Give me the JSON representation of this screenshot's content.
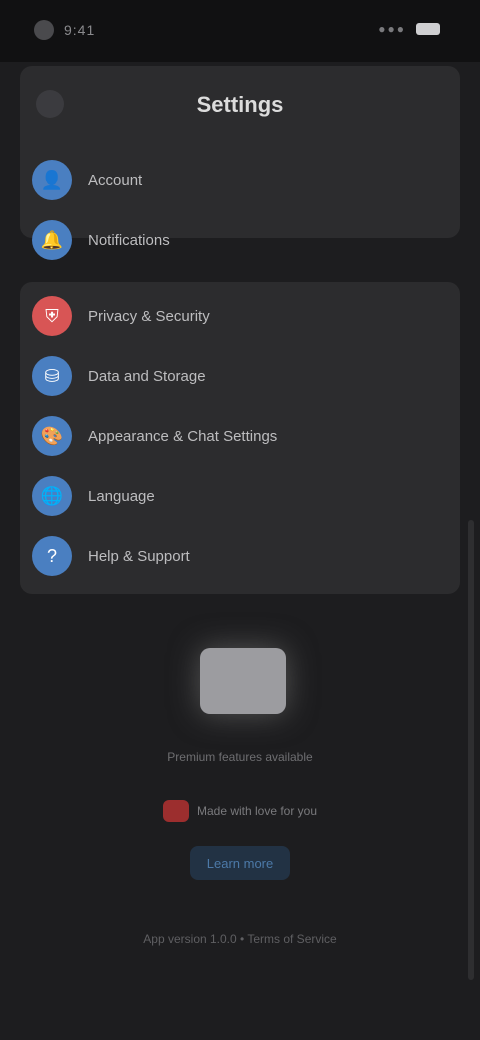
{
  "status": {
    "time": "9:41",
    "signal": "●●●"
  },
  "header": {
    "title": "Settings"
  },
  "group1": {
    "items": [
      {
        "label": "Account",
        "icon": "person-icon"
      },
      {
        "label": "Notifications",
        "icon": "bell-icon"
      }
    ]
  },
  "group2": {
    "items": [
      {
        "label": "Privacy & Security",
        "icon": "shield-icon"
      },
      {
        "label": "Data and Storage",
        "icon": "database-icon"
      },
      {
        "label": "Appearance & Chat Settings",
        "icon": "palette-icon"
      },
      {
        "label": "Language",
        "icon": "globe-icon"
      },
      {
        "label": "Help & Support",
        "icon": "help-icon"
      }
    ]
  },
  "promo": {
    "subtitle": "Premium features available",
    "line": "Made with love for you",
    "button": "Learn more",
    "footer": "App version 1.0.0 • Terms of Service"
  }
}
